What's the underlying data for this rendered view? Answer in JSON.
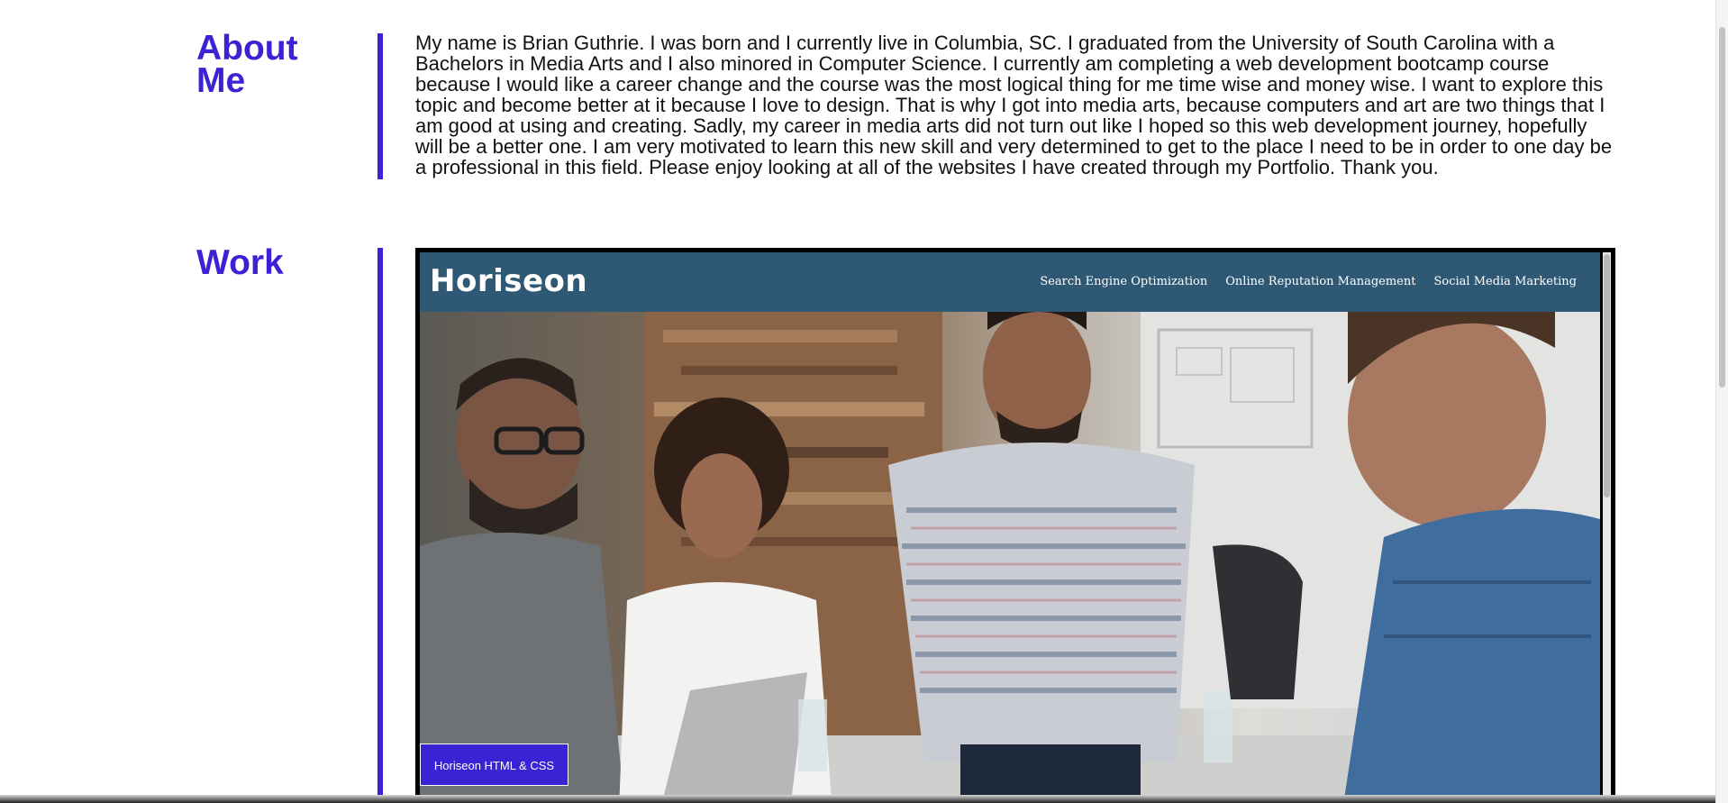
{
  "about": {
    "heading": "About Me",
    "text": "My name is Brian Guthrie. I was born and I currently live in Columbia, SC. I graduated from the University of South Carolina with a Bachelors in Media Arts and I also minored in Computer Science. I currently am completing a web development bootcamp course because I would like a career change and the course was the most logical thing for me time wise and money wise. I want to explore this topic and become better at it because I love to design. That is why I got into media arts, because computers and art are two things that I am good at using and creating. Sadly, my career in media arts did not turn out like I hoped so this web development journey, hopefully will be a better one. I am very motivated to learn this new skill and very determined to get to the place I need to be in order to one day be a professional in this field. Please enjoy looking at all of the websites I have created through my Portfolio. Thank you."
  },
  "work": {
    "heading": "Work",
    "project": {
      "site_logo": "Horiseon",
      "nav": [
        "Search Engine Optimization",
        "Online Reputation Management",
        "Social Media Marketing"
      ],
      "label": "Horiseon HTML & CSS"
    }
  },
  "colors": {
    "accent": "#3b22d4",
    "site_header": "#2e5873"
  }
}
